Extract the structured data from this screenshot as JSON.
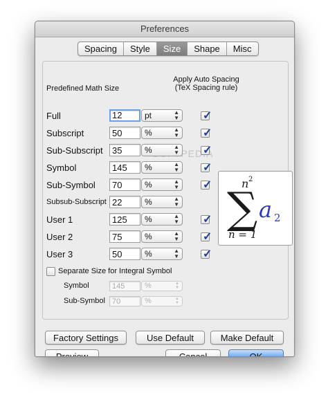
{
  "window": {
    "title": "Preferences"
  },
  "tabs": [
    {
      "label": "Spacing",
      "active": false
    },
    {
      "label": "Style",
      "active": false
    },
    {
      "label": "Size",
      "active": true
    },
    {
      "label": "Shape",
      "active": false
    },
    {
      "label": "Misc",
      "active": false
    }
  ],
  "headers": {
    "left": "Predefined Math Size",
    "right_line1": "Apply Auto Spacing",
    "right_line2": "(TeX Spacing rule)"
  },
  "rows": [
    {
      "label": "Full",
      "value": "12",
      "unit": "pt",
      "checked": true
    },
    {
      "label": "Subscript",
      "value": "50",
      "unit": "%",
      "checked": true
    },
    {
      "label": "Sub-Subscript",
      "value": "35",
      "unit": "%",
      "checked": true
    },
    {
      "label": "Symbol",
      "value": "145",
      "unit": "%",
      "checked": true
    },
    {
      "label": "Sub-Symbol",
      "value": "70",
      "unit": "%",
      "checked": true
    },
    {
      "label": "Subsub-Subscript",
      "value": "22",
      "unit": "%",
      "checked": false
    },
    {
      "label": "User 1",
      "value": "125",
      "unit": "%",
      "checked": true
    },
    {
      "label": "User 2",
      "value": "75",
      "unit": "%",
      "checked": true
    },
    {
      "label": "User 3",
      "value": "50",
      "unit": "%",
      "checked": true
    }
  ],
  "integral": {
    "checkbox_label": "Separate Size for Integral Symbol",
    "checked": false,
    "symbol_label": "Symbol",
    "symbol_value": "145",
    "symbol_unit": "%",
    "subsymbol_label": "Sub-Symbol",
    "subsymbol_value": "70",
    "subsymbol_unit": "%"
  },
  "preview": {
    "upper": "n",
    "upper_exp": "2",
    "sigma": "∑",
    "term": "a",
    "term_sub": "2",
    "lower": "n = 1"
  },
  "watermark": "SOFTPEDIA",
  "buttons": {
    "factory": "Factory Settings",
    "use_default": "Use Default",
    "make_default": "Make Default",
    "preview": "Preview",
    "cancel": "Cancel",
    "ok": "OK"
  },
  "colors": {
    "accent": "#6eaaf0",
    "check": "#1c3f9c"
  }
}
